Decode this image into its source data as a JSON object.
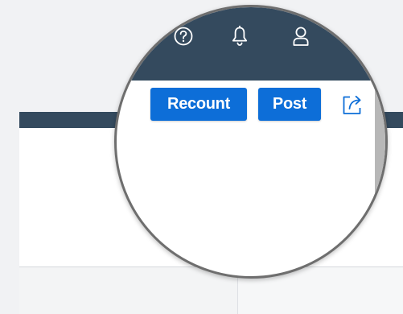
{
  "toolbar": {
    "recount_label": "Recount",
    "post_label": "Post"
  },
  "icons": {
    "help": "help-circle-icon",
    "notifications": "bell-icon",
    "user": "user-icon",
    "share": "share-icon"
  },
  "colors": {
    "topbar": "#344a5e",
    "primary_button": "#0d6ed8",
    "page_background": "#f1f2f4",
    "lens_border": "#6e6e6e"
  }
}
